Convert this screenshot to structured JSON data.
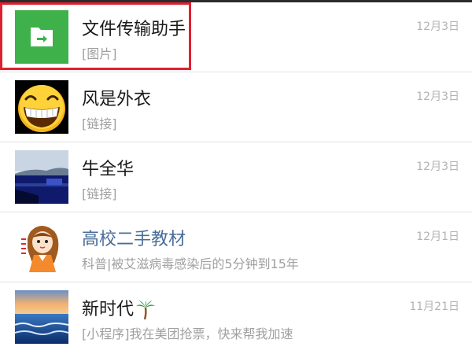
{
  "chats": [
    {
      "name": "文件传输助手",
      "preview": "[图片]",
      "time": "12月3日",
      "avatar_icon": "folder-transfer-icon"
    },
    {
      "name": "风是外衣",
      "preview": "[链接]",
      "time": "12月3日",
      "avatar_icon": "laughing-emoji-icon"
    },
    {
      "name": "牛全华",
      "preview": "[链接]",
      "time": "12月3日",
      "avatar_icon": "landscape-photo-icon"
    },
    {
      "name": "高校二手教材",
      "preview": "科普|被艾滋病毒感染后的5分钟到15年",
      "time": "12月1日",
      "avatar_icon": "cartoon-girl-icon"
    },
    {
      "name": "新时代",
      "preview": "[小程序]我在美团抢票，快来帮我加速",
      "time": "11月21日",
      "avatar_icon": "sea-sunset-icon",
      "name_emoji": "palm-tree-icon"
    }
  ],
  "colors": {
    "file_transfer_green": "#3eb14b",
    "highlight_red": "#e02030",
    "official_account_blue": "#4a6d99"
  }
}
